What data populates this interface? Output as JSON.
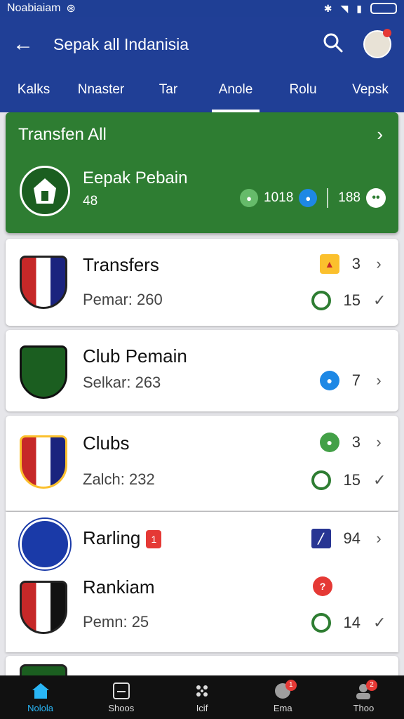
{
  "status_bar": {
    "left_text": "Noabiaiam"
  },
  "app_bar": {
    "title": "Sepak all Indanisia"
  },
  "tabs": [
    {
      "label": "Kalks"
    },
    {
      "label": "Nnaster"
    },
    {
      "label": "Tar"
    },
    {
      "label": "Anole",
      "active": true
    },
    {
      "label": "Rolu"
    },
    {
      "label": "Vepsk"
    }
  ],
  "hero": {
    "title": "Transfen All",
    "club_name": "Eepak Pebain",
    "count": "48",
    "stat1": "1018",
    "stat2": "188"
  },
  "cards": [
    {
      "title": "Transfers",
      "subtitle": "Pemar: 260",
      "stat_top": "3",
      "stat_bottom": "15"
    },
    {
      "title": "Club Pemain",
      "subtitle": "Selkar: 263",
      "stat_top": "7"
    },
    {
      "title": "Clubs",
      "subtitle": "Zalch: 232",
      "stat_top": "3",
      "stat_bottom": "15"
    },
    {
      "title": "Rarling",
      "badge": "1",
      "title2": "Rankiam",
      "subtitle": "Pemn: 25",
      "stat_top": "94",
      "stat_bottom": "14"
    }
  ],
  "bottom_nav": [
    {
      "label": "Nolola",
      "icon": "home-icon",
      "active": true
    },
    {
      "label": "Shoos",
      "icon": "scoreboard-icon"
    },
    {
      "label": "Icif",
      "icon": "ball-icon"
    },
    {
      "label": "Ema",
      "icon": "notification-icon",
      "badge": "1"
    },
    {
      "label": "Thoo",
      "icon": "profile-icon",
      "badge": "2"
    }
  ],
  "colors": {
    "primary": "#203f96",
    "hero_green": "#2e7d32",
    "accent_blue": "#29b6f6",
    "badge_red": "#e53935"
  }
}
